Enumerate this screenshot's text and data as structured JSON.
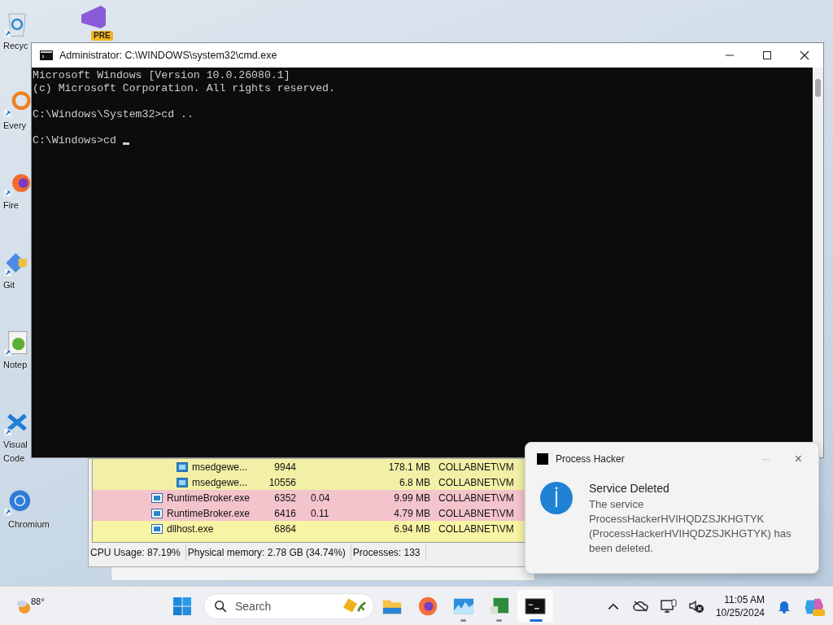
{
  "pinned_badge": "PRE",
  "desktop_icons": [
    {
      "kind": "recycle",
      "lines": [
        "Recyc"
      ]
    },
    {
      "kind": "orange",
      "lines": [
        "Every"
      ]
    },
    {
      "kind": "firefox",
      "lines": [
        "Fire"
      ]
    },
    {
      "kind": "git",
      "lines": [
        "Git"
      ]
    },
    {
      "kind": "notepad",
      "lines": [
        "Notep"
      ]
    },
    {
      "kind": "vscode",
      "lines": [
        "Visual",
        "Code"
      ]
    },
    {
      "kind": "chromium",
      "lines": [
        "Chromium"
      ]
    }
  ],
  "process_hacker": {
    "rows": [
      {
        "kind": "nested",
        "name": "msedgewe...",
        "pid": "9944",
        "cpu": "",
        "memory": "178.1 MB",
        "user": "COLLABNET\\VM",
        "color": "#f2f0a6"
      },
      {
        "kind": "nested",
        "name": "msedgewe...",
        "pid": "10556",
        "cpu": "",
        "memory": "6.8 MB",
        "user": "COLLABNET\\VM",
        "color": "#f2f0a6"
      },
      {
        "kind": "process",
        "name": "RuntimeBroker.exe",
        "pid": "6352",
        "cpu": "0.04",
        "memory": "9.99 MB",
        "user": "COLLABNET\\VM",
        "color": "#f4c4cc"
      },
      {
        "kind": "process",
        "name": "RuntimeBroker.exe",
        "pid": "6416",
        "cpu": "0.11",
        "memory": "4.79 MB",
        "user": "COLLABNET\\VM",
        "color": "#f4c4cc"
      },
      {
        "kind": "process",
        "name": "dllhost.exe",
        "pid": "6864",
        "cpu": "",
        "memory": "6.94 MB",
        "user": "COLLABNET\\VM",
        "color": "#f7f4a4"
      }
    ],
    "status_bar": [
      "CPU Usage: 87.19%",
      "Physical memory: 2.78 GB (34.74%)",
      "Processes: 133"
    ]
  },
  "cmd_window": {
    "title": "Administrator: C:\\WINDOWS\\system32\\cmd.exe",
    "cursor": true,
    "blocks": [
      [
        "Microsoft Windows [Version 10.0.26080.1]",
        "(c) Microsoft Corporation. All rights reserved."
      ],
      [
        "C:\\Windows\\System32>cd .."
      ],
      [
        "C:\\Windows>cd "
      ]
    ]
  },
  "toast": {
    "app": "Process Hacker",
    "more": "···",
    "close": "×",
    "title": "Service Deleted",
    "body": "The service ProcessHackerHVIHQDZSJKHGTYK (ProcessHackerHVIHQDZSJKHGTYK) has been deleted."
  },
  "taskbar": {
    "weather": "88°",
    "search": {
      "placeholder": "Search"
    },
    "apps": [
      {
        "kind": "folder",
        "running": false,
        "selected": false
      },
      {
        "kind": "firefox",
        "running": false,
        "selected": false
      },
      {
        "kind": "monitor",
        "running": true,
        "selected": false
      },
      {
        "kind": "board",
        "running": true,
        "selected": false
      },
      {
        "kind": "terminal",
        "running": true,
        "selected": true
      }
    ],
    "time": "11:05 AM",
    "date": "10/25/2024"
  }
}
